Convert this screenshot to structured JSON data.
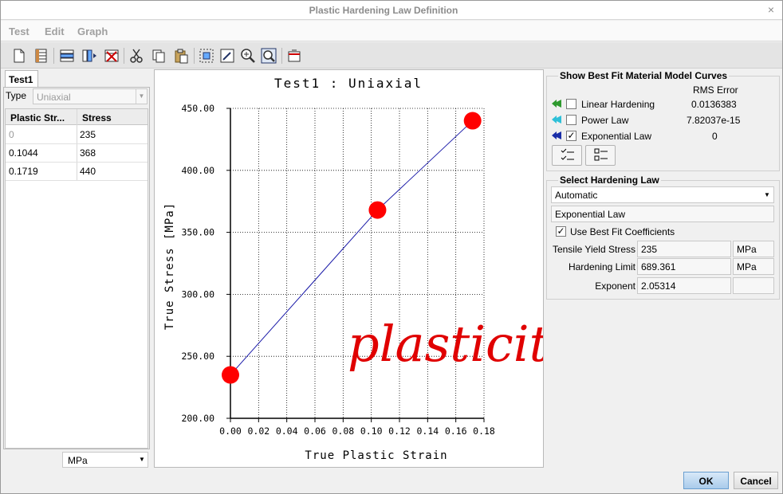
{
  "window": {
    "title": "Plastic Hardening Law Definition",
    "close": "×"
  },
  "menu": {
    "test": "Test",
    "edit": "Edit",
    "graph": "Graph"
  },
  "toolbar": [
    "new-document-icon",
    "spreadsheet-icon",
    "insert-row-icon",
    "insert-column-icon",
    "delete-icon",
    "cut-icon",
    "copy-icon",
    "paste-icon",
    "select-grid-icon",
    "edit-chart-icon",
    "zoom-in-icon",
    "zoom-fit-icon",
    "export-icon"
  ],
  "left": {
    "tab": "Test1",
    "type_label": "Type",
    "type_value": "Uniaxial",
    "columns": [
      "Plastic Str...",
      "Stress"
    ],
    "rows": [
      [
        "0",
        "235"
      ],
      [
        "0.1044",
        "368"
      ],
      [
        "0.1719",
        "440"
      ]
    ],
    "unit": "MPa"
  },
  "chart_data": {
    "type": "line",
    "title": "Test1 : Uniaxial",
    "xlabel": "True Plastic Strain",
    "ylabel": "True Stress [MPa]",
    "xlim": [
      0,
      0.18
    ],
    "ylim": [
      200,
      450
    ],
    "x_ticks": [
      "0.00",
      "0.02",
      "0.04",
      "0.06",
      "0.08",
      "0.10",
      "0.12",
      "0.14",
      "0.16",
      "0.18"
    ],
    "y_ticks": [
      "200.00",
      "250.00",
      "300.00",
      "350.00",
      "400.00",
      "450.00"
    ],
    "grid": true,
    "series": [
      {
        "x": [
          0,
          0.1044,
          0.1719
        ],
        "y": [
          235,
          368,
          440
        ]
      }
    ],
    "colors": {
      "line": "#1a1aa8",
      "marker": "#ff0000",
      "annotation": "#e00000"
    },
    "annotation": "plasticity"
  },
  "best_fit": {
    "title": "Show Best Fit Material Model Curves",
    "rms_header": "RMS Error",
    "items": [
      {
        "label": "Linear Hardening",
        "checked": false,
        "rms": "0.0136383",
        "color": "#2e9a2e"
      },
      {
        "label": "Power Law",
        "checked": false,
        "rms": "7.82037e-15",
        "color": "#2ec0d8"
      },
      {
        "label": "Exponential Law",
        "checked": true,
        "rms": "0",
        "color": "#1a2ea8"
      }
    ]
  },
  "hardening": {
    "title": "Select Hardening Law",
    "selector": "Automatic",
    "law": "Exponential Law",
    "use_best_fit": "Use Best Fit Coefficients",
    "use_best_fit_checked": true,
    "params": [
      {
        "label": "Tensile Yield Stress",
        "value": "235",
        "unit": "MPa"
      },
      {
        "label": "Hardening Limit",
        "value": "689.361",
        "unit": "MPa"
      },
      {
        "label": "Exponent",
        "value": "2.05314",
        "unit": ""
      }
    ]
  },
  "buttons": {
    "ok": "OK",
    "cancel": "Cancel"
  }
}
